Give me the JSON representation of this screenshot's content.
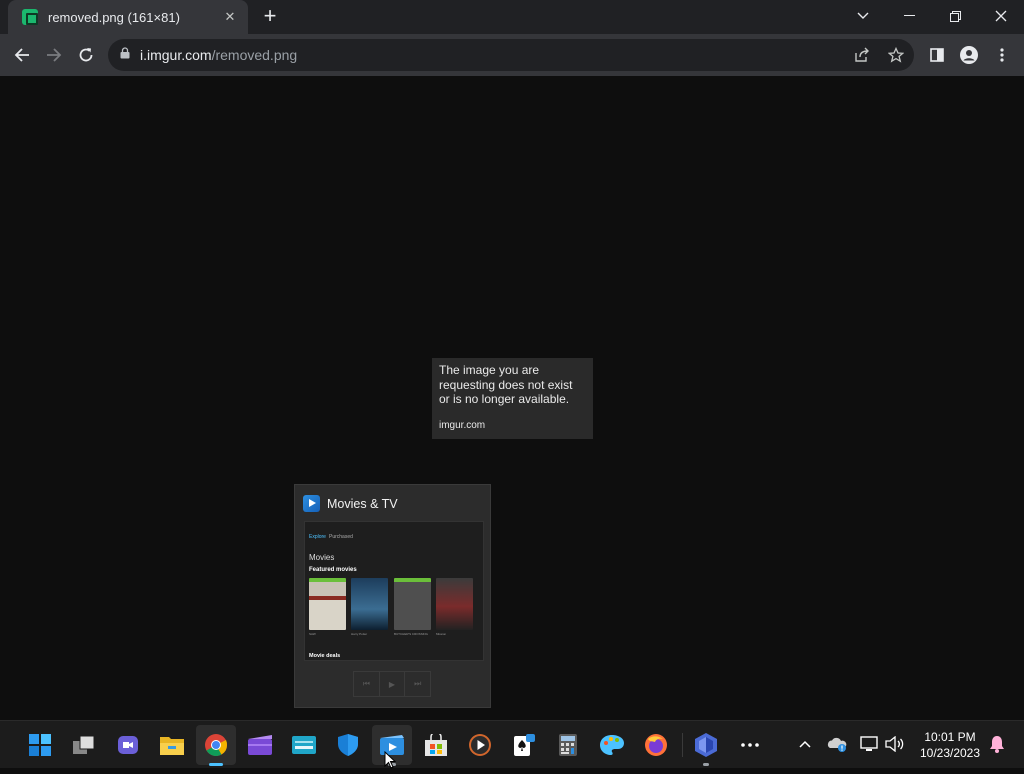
{
  "browser": {
    "tab": {
      "title": "removed.png (161×81)",
      "close_icon": "close-icon"
    },
    "new_tab_label": "+",
    "address": {
      "host": "i.imgur.com",
      "path": "/removed.png"
    }
  },
  "page": {
    "message": "The image you are requesting does not exist or is no longer available.",
    "site": "imgur.com"
  },
  "preview": {
    "app_title": "Movies & TV",
    "thumb": {
      "tabs": [
        "Explore",
        "Purchased"
      ],
      "heading": "Movies",
      "featured": "Featured movies",
      "deals": "Movie deals",
      "posters": [
        {
          "label": "SAW",
          "color": "#c9c2b5"
        },
        {
          "label": "Harry Potter",
          "color": "#1d3d5c"
        },
        {
          "label": "BUTCHER'S CROSSING",
          "color": "#4f4f4f"
        },
        {
          "label": "Mission",
          "color": "#3b3b3b"
        }
      ]
    }
  },
  "taskbar": {
    "clock_time": "10:01 PM",
    "clock_date": "10/23/2023"
  },
  "colors": {
    "tab_bg": "#35363a",
    "titlebar_bg": "#202124",
    "page_bg": "#0e0e0e",
    "accent_blue": "#4cc2ff"
  }
}
